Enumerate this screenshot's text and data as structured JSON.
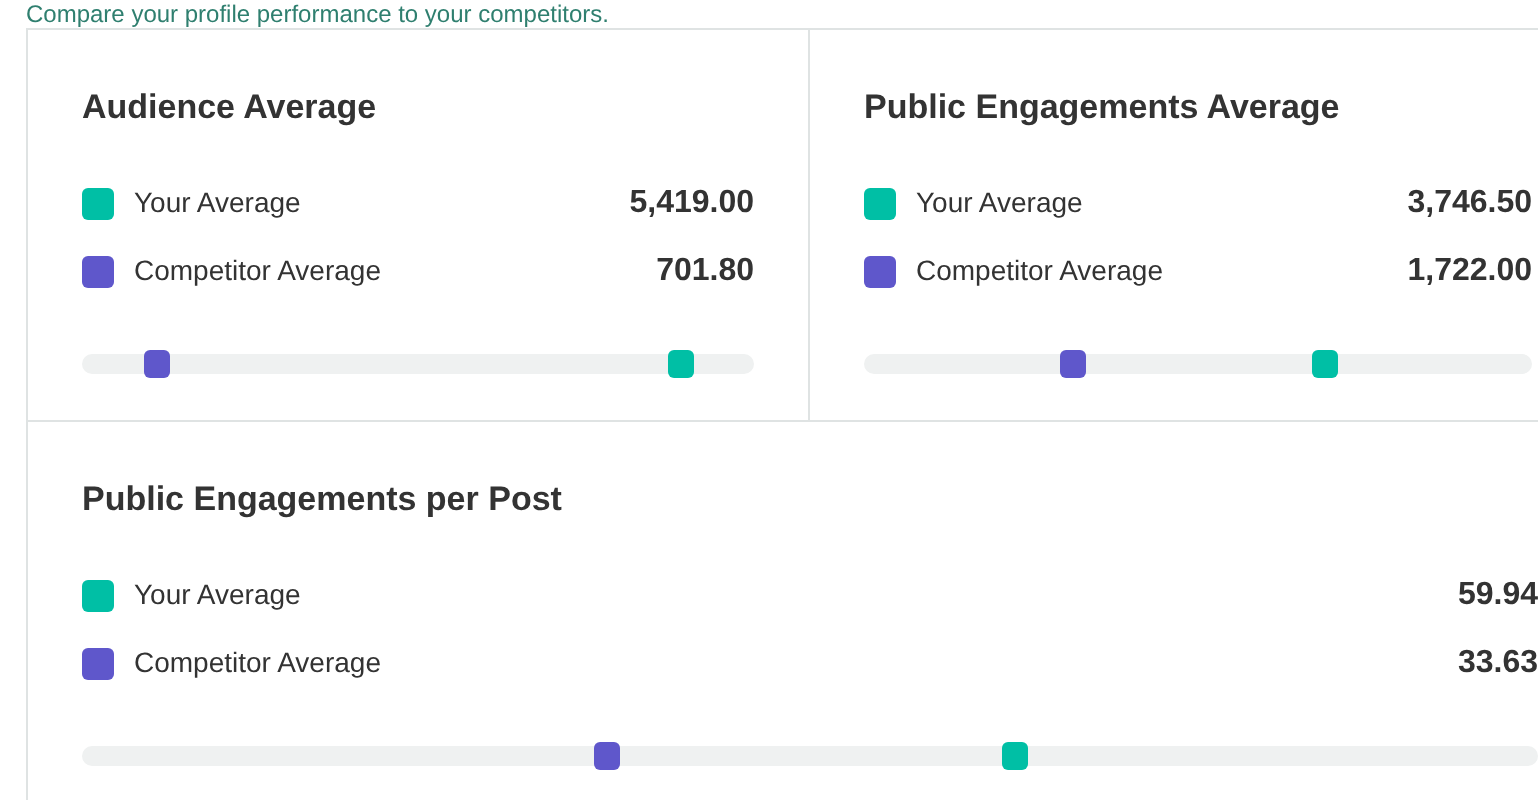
{
  "subtitle": "Compare your profile performance to your competitors.",
  "panels": [
    {
      "title": "Audience Average",
      "series": [
        {
          "label": "Your Average",
          "value": "5,419.00",
          "color": "#00bfa5",
          "level": 0.89
        },
        {
          "label": "Competitor Average",
          "value": "701.80",
          "color": "#5f57cb",
          "level": 0.11
        }
      ]
    },
    {
      "title": "Public Engagements Average",
      "series": [
        {
          "label": "Your Average",
          "value": "3,746.50",
          "color": "#00bfa5",
          "level": 0.69
        },
        {
          "label": "Competitor Average",
          "value": "1,722.00",
          "color": "#5f57cb",
          "level": 0.31
        }
      ]
    },
    {
      "title": "Public Engagements per Post",
      "series": [
        {
          "label": "Your Average",
          "value": "59.94",
          "color": "#00bfa5",
          "level": 0.64
        },
        {
          "label": "Competitor Average",
          "value": "33.63",
          "color": "#5f57cb",
          "level": 0.36
        }
      ]
    }
  ]
}
